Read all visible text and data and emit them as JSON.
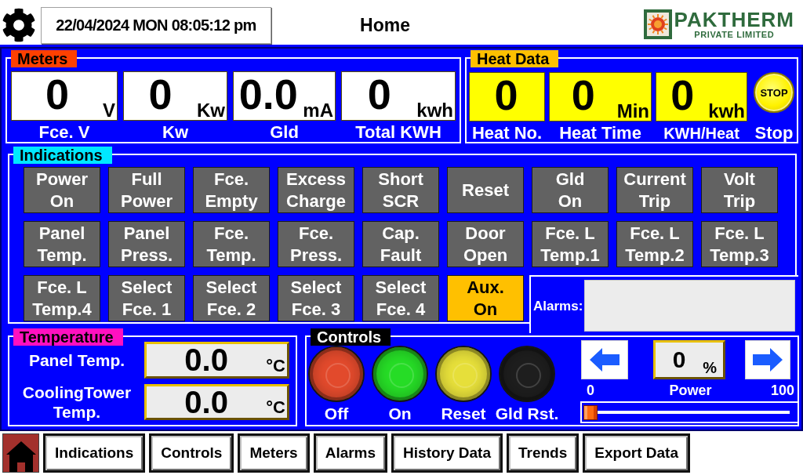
{
  "header": {
    "datetime": "22/04/2024 MON 08:05:12 pm",
    "title": "Home",
    "logo": {
      "name": "PAKTHERM",
      "tagline": "PRIVATE LIMITED"
    }
  },
  "meters": {
    "title": "Meters",
    "items": [
      {
        "value": "0",
        "unit": "V",
        "label": "Fce. V"
      },
      {
        "value": "0",
        "unit": "Kw",
        "label": "Kw"
      },
      {
        "value": "0.0",
        "unit": "mA",
        "label": "Gld"
      },
      {
        "value": "0",
        "unit": "kwh",
        "label": "Total KWH"
      }
    ]
  },
  "heat_data": {
    "title": "Heat Data",
    "items": [
      {
        "value": "0",
        "label": "Heat No."
      },
      {
        "value": "0",
        "unit": "Min",
        "label": "Heat Time"
      },
      {
        "value": "0",
        "unit": "kwh",
        "label": "KWH/Heat"
      }
    ],
    "stop": {
      "text": "STOP",
      "label": "Stop"
    }
  },
  "indications": {
    "title": "Indications",
    "items": [
      {
        "label": "Power\nOn",
        "on": false
      },
      {
        "label": "Full\nPower",
        "on": false
      },
      {
        "label": "Fce.\nEmpty",
        "on": false
      },
      {
        "label": "Excess\nCharge",
        "on": false
      },
      {
        "label": "Short\nSCR",
        "on": false
      },
      {
        "label": "Reset",
        "on": false
      },
      {
        "label": "Gld\nOn",
        "on": false
      },
      {
        "label": "Current\nTrip",
        "on": false
      },
      {
        "label": "Volt\nTrip",
        "on": false
      },
      {
        "label": "Panel\nTemp.",
        "on": false
      },
      {
        "label": "Panel\nPress.",
        "on": false
      },
      {
        "label": "Fce.\nTemp.",
        "on": false
      },
      {
        "label": "Fce.\nPress.",
        "on": false
      },
      {
        "label": "Cap.\nFault",
        "on": false
      },
      {
        "label": "Door\nOpen",
        "on": false
      },
      {
        "label": "Fce. L\nTemp.1",
        "on": false
      },
      {
        "label": "Fce. L\nTemp.2",
        "on": false
      },
      {
        "label": "Fce. L\nTemp.3",
        "on": false
      },
      {
        "label": "Fce. L\nTemp.4",
        "on": false
      },
      {
        "label": "Select\nFce. 1",
        "on": false
      },
      {
        "label": "Select\nFce. 2",
        "on": false
      },
      {
        "label": "Select\nFce. 3",
        "on": false
      },
      {
        "label": "Select\nFce. 4",
        "on": false
      },
      {
        "label": "Aux.\nOn",
        "on": true
      }
    ],
    "alarms": {
      "label": "Alarms:"
    }
  },
  "temperature": {
    "title": "Temperature",
    "items": [
      {
        "label": "Panel Temp.",
        "value": "0.0",
        "unit": "°C"
      },
      {
        "label": "CoolingTower\nTemp.",
        "value": "0.0",
        "unit": "°C"
      }
    ]
  },
  "controls": {
    "title": "Controls",
    "buttons": [
      {
        "label": "Off",
        "color": "#e24a2c"
      },
      {
        "label": "On",
        "color": "#26dc26"
      },
      {
        "label": "Reset",
        "color": "#e6df3a"
      },
      {
        "label": "Gld Rst.",
        "color": "#1e1e1e"
      }
    ],
    "power": {
      "value": "0",
      "unit": "%",
      "min": "0",
      "label": "Power",
      "max": "100",
      "level": 0
    }
  },
  "nav": {
    "items": [
      "Indications",
      "Controls",
      "Meters",
      "Alarms",
      "History Data",
      "Trends",
      "Export Data"
    ]
  }
}
